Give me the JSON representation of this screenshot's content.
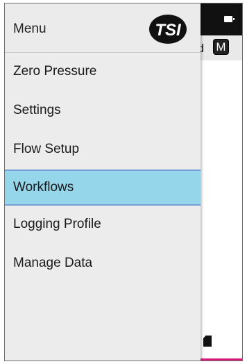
{
  "drawer": {
    "title": "Menu",
    "logo_text": "TSI",
    "items": [
      {
        "label": "Zero Pressure",
        "selected": false
      },
      {
        "label": "Settings",
        "selected": false
      },
      {
        "label": "Flow Setup",
        "selected": false
      },
      {
        "label": "Workflows",
        "selected": true
      },
      {
        "label": "Logging Profile",
        "selected": false
      },
      {
        "label": "Manage Data",
        "selected": false
      }
    ]
  },
  "background_app": {
    "subbar_text_fragment": "rd",
    "mode_badge": "M",
    "icons": [
      "battery-icon",
      "sd-card-icon"
    ]
  },
  "colors": {
    "selected_background": "#96d6ea",
    "selected_border": "#7b9fd8",
    "drawer_background": "#ececec",
    "top_bar": "#111111",
    "bottom_accent": "#d81b78"
  }
}
